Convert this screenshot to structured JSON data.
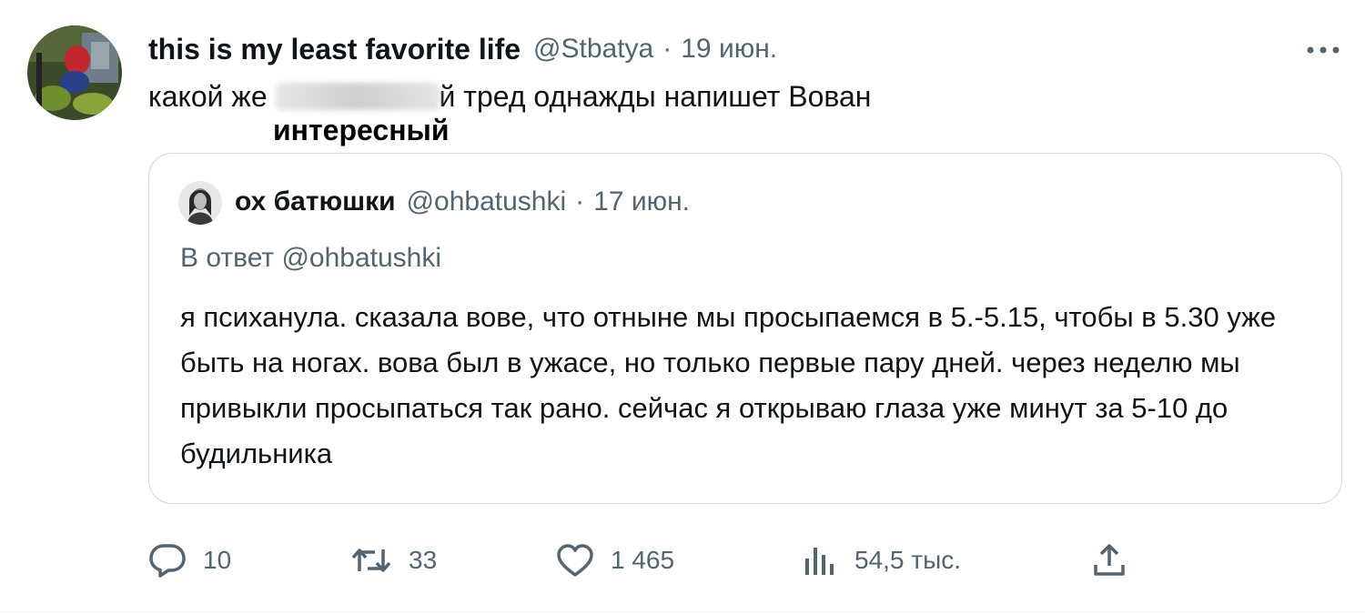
{
  "tweet": {
    "author_name": "this is my least favorite life",
    "handle": "@Stbatya",
    "separator": "·",
    "date": "19 июн.",
    "text_before": "какой же",
    "text_after": "й тред однажды напишет Вован",
    "overlay_word": "интересный"
  },
  "quote": {
    "author_name": "ох батюшки",
    "handle": "@ohbatushki",
    "separator": "·",
    "date": "17 июн.",
    "reply_to": "В ответ @ohbatushki",
    "text": "я психанула. сказала вове, что отныне мы просыпаемся в 5.-5.15, чтобы в 5.30 уже быть на ногах. вова был в ужасе, но только первые пару дней. через неделю мы привыкли просыпаться так рано. сейчас я открываю глаза уже минут за 5-10 до будильника"
  },
  "actions": {
    "replies": "10",
    "retweets": "33",
    "likes": "1 465",
    "views": "54,5 тыс."
  },
  "icons": {
    "more": "more-icon",
    "reply": "reply-icon",
    "retweet": "retweet-icon",
    "like": "heart-icon",
    "views": "views-icon",
    "share": "share-icon"
  },
  "colors": {
    "text": "#0f1419",
    "secondary": "#536471",
    "border": "#cfd9de"
  }
}
